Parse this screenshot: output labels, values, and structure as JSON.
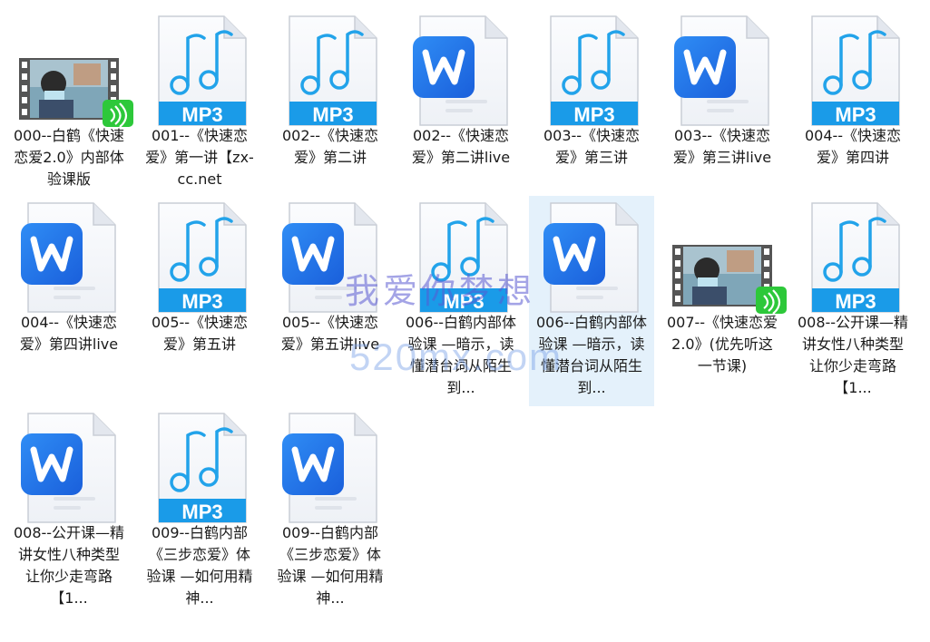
{
  "files": [
    {
      "name": "000--白鹤《快速恋爱2.0》内部体验课版",
      "type": "video"
    },
    {
      "name": "001--《快速恋爱》第一讲【zx-cc.net",
      "type": "mp3"
    },
    {
      "name": "002--《快速恋爱》第二讲",
      "type": "mp3"
    },
    {
      "name": "002--《快速恋爱》第二讲live",
      "type": "word"
    },
    {
      "name": "003--《快速恋爱》第三讲",
      "type": "mp3"
    },
    {
      "name": "003--《快速恋爱》第三讲live",
      "type": "word"
    },
    {
      "name": "004--《快速恋爱》第四讲",
      "type": "mp3"
    },
    {
      "name": "004--《快速恋爱》第四讲live",
      "type": "word"
    },
    {
      "name": "005--《快速恋爱》第五讲",
      "type": "mp3"
    },
    {
      "name": "005--《快速恋爱》第五讲live",
      "type": "word"
    },
    {
      "name": "006--白鹤内部体验课 —暗示，读懂潜台词从陌生到...",
      "type": "mp3"
    },
    {
      "name": "006--白鹤内部体验课 —暗示，读懂潜台词从陌生到...",
      "type": "word",
      "selected": true
    },
    {
      "name": "007--《快速恋爱2.0》(优先听这一节课)",
      "type": "video"
    },
    {
      "name": "008--公开课—精讲女性八种类型 让你少走弯路【1...",
      "type": "mp3"
    },
    {
      "name": "008--公开课—精讲女性八种类型 让你少走弯路【1...",
      "type": "word"
    },
    {
      "name": "009--白鹤内部《三步恋爱》体验课 —如何用精神...",
      "type": "mp3"
    },
    {
      "name": "009--白鹤内部《三步恋爱》体验课 —如何用精神...",
      "type": "word"
    }
  ],
  "mp3_badge": "MP3",
  "watermark": {
    "line1": "我爱你梦想",
    "line2": "520mx.com"
  },
  "colors": {
    "mp3_blue": "#1a9be8",
    "word_blue": "#1f6fe6",
    "selection": "#e4f1fb"
  }
}
